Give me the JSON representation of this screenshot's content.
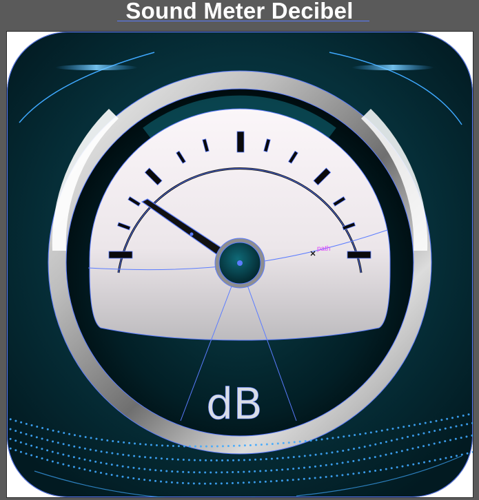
{
  "header": {
    "title": "Sound Meter Decibel"
  },
  "gauge": {
    "unit_label": "dB",
    "needle_value_fraction": 0.14
  },
  "selection": {
    "path_label": "path"
  },
  "colors": {
    "canvas": "#5a5a5a",
    "icon_bg": "#052a33",
    "accent": "#3fa9ff",
    "selection": "#5b7cff",
    "dial_face": "#f4eef2",
    "path_label": "#e040fb"
  }
}
